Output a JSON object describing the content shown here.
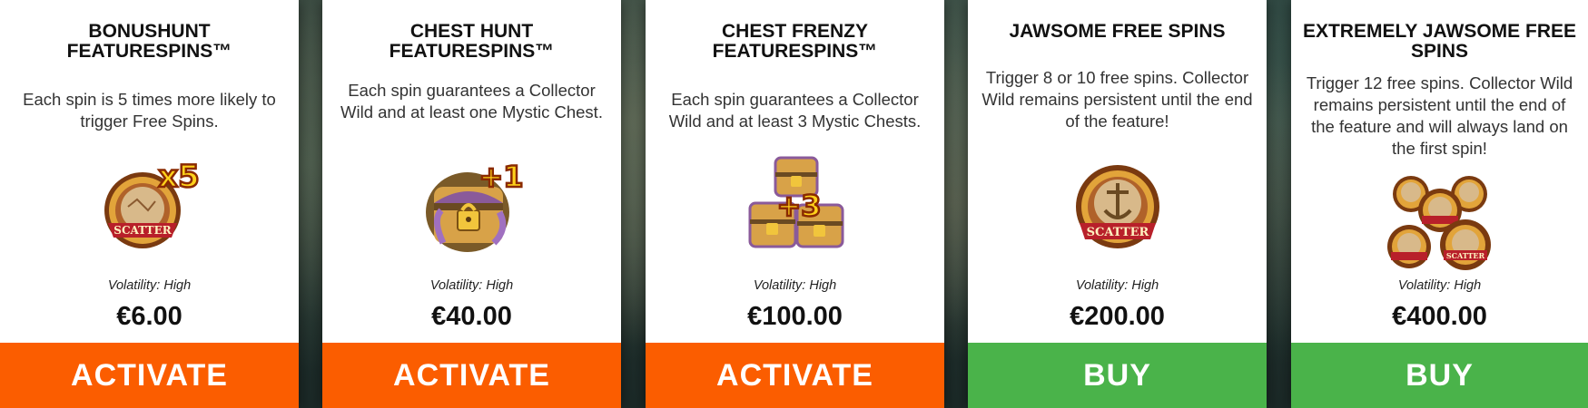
{
  "colors": {
    "activate": "#fb5d00",
    "buy": "#4ab34a",
    "card_bg": "#ffffff"
  },
  "volatility_label": "Volatility:",
  "cards": [
    {
      "title_line1": "BONUSHUNT",
      "title_line2": "FEATURESPINS™",
      "desc": "Each spin is 5 times more likely to trigger Free Spins.",
      "icon": "scatter-x5-icon",
      "badge": "x5",
      "scatter": "SCATTER",
      "volatility": "High",
      "price": "€6.00",
      "button": "ACTIVATE"
    },
    {
      "title_line1": "CHEST HUNT",
      "title_line2": "FEATURESPINS™",
      "desc": "Each spin guarantees a Collector Wild and at least one Mystic Chest.",
      "icon": "mystic-chest-plus1-icon",
      "badge": "+1",
      "volatility": "High",
      "price": "€40.00",
      "button": "ACTIVATE"
    },
    {
      "title_line1": "CHEST FRENZY",
      "title_line2": "FEATURESPINS™",
      "desc": "Each spin guarantees a Collector Wild and at least 3 Mystic Chests.",
      "icon": "mystic-chests-plus3-icon",
      "badge": "+3",
      "volatility": "High",
      "price": "€100.00",
      "button": "ACTIVATE"
    },
    {
      "title_line1": "JAWSOME FREE SPINS",
      "title_line2": "",
      "desc": "Trigger 8 or 10 free spins. Collector Wild remains persistent until the end of the feature!",
      "icon": "scatter-icon",
      "scatter": "SCATTER",
      "volatility": "High",
      "price": "€200.00",
      "button": "BUY"
    },
    {
      "title_line1": "EXTREMELY JAWSOME FREE",
      "title_line2": "SPINS",
      "desc": "Trigger 12 free spins. Collector Wild remains persistent until the end of the feature and will always land on the first spin!",
      "icon": "scatter-cluster-icon",
      "scatter": "SCATTER",
      "volatility": "High",
      "price": "€400.00",
      "button": "BUY"
    }
  ]
}
